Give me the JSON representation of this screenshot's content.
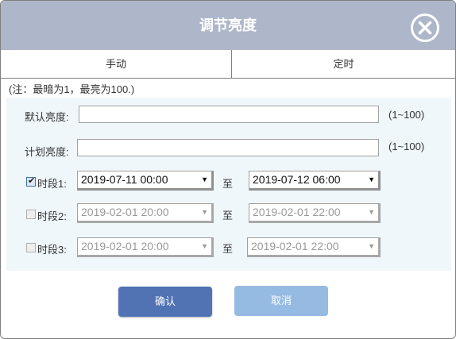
{
  "dialog": {
    "title": "调节亮度",
    "close_icon": "close-circle-icon"
  },
  "tabs": [
    {
      "label": "手动"
    },
    {
      "label": "定时"
    }
  ],
  "note": "(注：最暗为1，最亮为100.)",
  "default_brightness": {
    "label": "默认亮度:",
    "value": "",
    "range": "(1~100)"
  },
  "plan_brightness": {
    "label": "计划亮度:",
    "value": "",
    "range": "(1~100)"
  },
  "periods": [
    {
      "label": "时段1:",
      "checked": true,
      "start": "2019-07-11 00:00",
      "to": "至",
      "end": "2019-07-12  06:00"
    },
    {
      "label": "时段2:",
      "checked": false,
      "start": "2019-02-01 20:00",
      "to": "至",
      "end": "2019-02-01 22:00"
    },
    {
      "label": "时段3:",
      "checked": false,
      "start": "2019-02-01 20:00",
      "to": "至",
      "end": "2019-02-01 22:00"
    }
  ],
  "buttons": {
    "ok": "确认",
    "cancel": "取消"
  },
  "colors": {
    "titlebar": "#aeb6c9",
    "panel": "#f0f7fb",
    "ok_button": "#5173b3",
    "cancel_button": "#96bbe3"
  }
}
